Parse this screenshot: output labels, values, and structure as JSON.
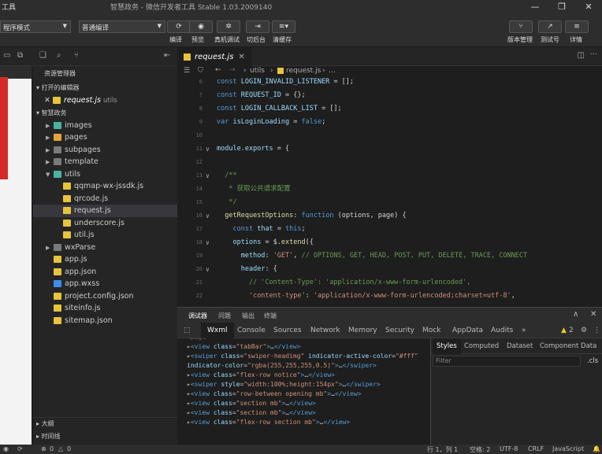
{
  "titlebar": {
    "app_name": "工具",
    "window_title": "智慧政务 - 微信开发者工具 Stable 1.03.2009140"
  },
  "toolbar": {
    "mode_select": "程序模式",
    "compile_select": "普通编译",
    "buttons": [
      "编译",
      "预览",
      "真机调试",
      "切后台",
      "清缓存"
    ],
    "right_buttons": [
      "版本管理",
      "测试号",
      "详情"
    ]
  },
  "explorer": {
    "header": "资源管理器",
    "open_editors": "打开的编辑器",
    "open_file": "request.js",
    "open_file_path": "utils",
    "project": "智慧政务",
    "items": [
      {
        "label": "images",
        "type": "folder",
        "indent": 1,
        "twisty": "▶",
        "color": "#4ab4a4"
      },
      {
        "label": "pages",
        "type": "folder",
        "indent": 1,
        "twisty": "▶",
        "color": "#e8a33c"
      },
      {
        "label": "subpages",
        "type": "folder",
        "indent": 1,
        "twisty": "▶",
        "color": "#7a7a7a"
      },
      {
        "label": "template",
        "type": "folder",
        "indent": 1,
        "twisty": "▶",
        "color": "#7a7a7a"
      },
      {
        "label": "utils",
        "type": "folder",
        "indent": 1,
        "twisty": "▼",
        "color": "#4ab4a4"
      },
      {
        "label": "qqmap-wx-jssdk.js",
        "type": "js",
        "indent": 2,
        "twisty": "",
        "color": "#e8c33c"
      },
      {
        "label": "qrcode.js",
        "type": "js",
        "indent": 2,
        "twisty": "",
        "color": "#e8c33c"
      },
      {
        "label": "request.js",
        "type": "js",
        "indent": 2,
        "twisty": "",
        "color": "#e8c33c",
        "selected": true
      },
      {
        "label": "underscore.js",
        "type": "js",
        "indent": 2,
        "twisty": "",
        "color": "#e8c33c"
      },
      {
        "label": "util.js",
        "type": "js",
        "indent": 2,
        "twisty": "",
        "color": "#e8c33c"
      },
      {
        "label": "wxParse",
        "type": "folder",
        "indent": 1,
        "twisty": "▶",
        "color": "#7a7a7a"
      },
      {
        "label": "app.js",
        "type": "js",
        "indent": 1,
        "twisty": "",
        "color": "#e8c33c"
      },
      {
        "label": "app.json",
        "type": "json",
        "indent": 1,
        "twisty": "",
        "color": "#e8c33c"
      },
      {
        "label": "app.wxss",
        "type": "wxss",
        "indent": 1,
        "twisty": "",
        "color": "#3c8ee8"
      },
      {
        "label": "project.config.json",
        "type": "json",
        "indent": 1,
        "twisty": "",
        "color": "#e8c33c"
      },
      {
        "label": "siteinfo.js",
        "type": "js",
        "indent": 1,
        "twisty": "",
        "color": "#e8c33c"
      },
      {
        "label": "sitemap.json",
        "type": "json",
        "indent": 1,
        "twisty": "",
        "color": "#e8c33c"
      }
    ],
    "outline": "大纲",
    "timeline": "时间线"
  },
  "editor": {
    "tab": "request.js",
    "breadcrumb_dir": "utils",
    "breadcrumb_file": "request.js"
  },
  "code": [
    {
      "ln": "6",
      "fold": "",
      "html": "<span class=\"bl\">const</span> <span class=\"nm\">LOGIN_INVALID_LISTENER</span> <span class=\"pl\">= [];</span>"
    },
    {
      "ln": "7",
      "fold": "",
      "html": "<span class=\"bl\">const</span> <span class=\"nm\">REQUEST_ID</span> <span class=\"pl\">= {};</span>"
    },
    {
      "ln": "8",
      "fold": "",
      "html": "<span class=\"bl\">const</span> <span class=\"nm\">LOGIN_CALLBACK_LIST</span> <span class=\"pl\">= [];</span>"
    },
    {
      "ln": "9",
      "fold": "",
      "html": "<span class=\"bl\">var</span> <span class=\"nm\">isLoginLoading</span> <span class=\"pl\">= </span><span class=\"bl\">false</span><span class=\"pl\">;</span>"
    },
    {
      "ln": "10",
      "fold": "",
      "html": ""
    },
    {
      "ln": "11",
      "fold": "∨",
      "html": "<span class=\"nm\">module</span><span class=\"pl\">.</span><span class=\"nm\">exports</span> <span class=\"pl\">= {</span>"
    },
    {
      "ln": "12",
      "fold": "",
      "html": ""
    },
    {
      "ln": "13",
      "fold": "∨",
      "html": "  <span class=\"cm\">/**</span>"
    },
    {
      "ln": "14",
      "fold": "",
      "html": "   <span class=\"cm\">* 获取公共请求配置</span>"
    },
    {
      "ln": "15",
      "fold": "",
      "html": "   <span class=\"cm\">*/</span>"
    },
    {
      "ln": "16",
      "fold": "∨",
      "html": "  <span class=\"fn\">getRequestOptions</span><span class=\"pl\">: </span><span class=\"bl\">function</span> <span class=\"pl\">(options, page) {</span>"
    },
    {
      "ln": "17",
      "fold": "",
      "html": "    <span class=\"bl\">const</span> <span class=\"nm\">that</span> <span class=\"pl\">= </span><span class=\"bl\">this</span><span class=\"pl\">;</span>"
    },
    {
      "ln": "18",
      "fold": "∨",
      "html": "    <span class=\"nm\">options</span> <span class=\"pl\">= $.</span><span class=\"fn\">extend</span><span class=\"pl\">({</span>"
    },
    {
      "ln": "19",
      "fold": "",
      "html": "      <span class=\"nm\">method</span><span class=\"pl\">: </span><span class=\"st\">'GET'</span><span class=\"pl\">, </span><span class=\"cm\">// OPTIONS, GET, HEAD, POST, PUT, DELETE, TRACE, CONNECT</span>"
    },
    {
      "ln": "20",
      "fold": "∨",
      "html": "      <span class=\"nm\">header</span><span class=\"pl\">: {</span>"
    },
    {
      "ln": "21",
      "fold": "",
      "html": "        <span class=\"cm\">// 'Content-Type': 'application/x-www-form-urlencoded',</span>"
    },
    {
      "ln": "22",
      "fold": "",
      "html": "        <span class=\"st\">'content-type'</span><span class=\"pl\">: </span><span class=\"st\">'application/x-www-form-urlencoded;charset=utf-8'</span><span class=\"pl\">,</span>"
    }
  ],
  "devtools": {
    "top_tabs": [
      "调试器",
      "问题",
      "输出",
      "终端"
    ],
    "tabs": [
      "Wxml",
      "Console",
      "Sources",
      "Network",
      "Memory",
      "Security",
      "Mock",
      "AppData",
      "Audits",
      "»"
    ],
    "warning_count": "2",
    "dom": [
      {
        "indent": 0,
        "html": "<span class=\"tg\">&lt;view </span><span class=\"at\">class</span>=<span class=\"av\">\"tabBar\"</span><span class=\"tg\">&gt;</span><span class=\"tx2\">…</span><span class=\"tg\">&lt;/view&gt;</span>"
      },
      {
        "indent": 0,
        "html": "<span class=\"tg\">&lt;swiper </span><span class=\"at\">class</span>=<span class=\"av\">\"swiper-headimg\"</span> <span class=\"at\">indicator-active-color</span>=<span class=\"av\">\"#fff\"</span>"
      },
      {
        "indent": -1,
        "html": "<span class=\"at\">indicator-color</span>=<span class=\"av\">\"rgba(255,255,255,0.5)\"</span><span class=\"tg\">&gt;</span><span class=\"tx2\">…</span><span class=\"tg\">&lt;/swiper&gt;</span>"
      },
      {
        "indent": 0,
        "html": "<span class=\"tg\">&lt;view </span><span class=\"at\">class</span>=<span class=\"av\">\"flex-row notice\"</span><span class=\"tg\">&gt;</span><span class=\"tx2\">…</span><span class=\"tg\">&lt;/view&gt;</span>"
      },
      {
        "indent": 0,
        "html": "<span class=\"tg\">&lt;swiper </span><span class=\"at\">style</span>=<span class=\"av\">\"width:100%;height:154px\"</span><span class=\"tg\">&gt;</span><span class=\"tx2\">…</span><span class=\"tg\">&lt;/swiper&gt;</span>"
      },
      {
        "indent": 0,
        "html": "<span class=\"tg\">&lt;view </span><span class=\"at\">class</span>=<span class=\"av\">\"row-between opening mb\"</span><span class=\"tg\">&gt;</span><span class=\"tx2\">…</span><span class=\"tg\">&lt;/view&gt;</span>"
      },
      {
        "indent": 0,
        "html": "<span class=\"tg\">&lt;view </span><span class=\"at\">class</span>=<span class=\"av\">\"section mb\"</span><span class=\"tg\">&gt;</span><span class=\"tx2\">…</span><span class=\"tg\">&lt;/view&gt;</span>"
      },
      {
        "indent": 0,
        "html": "<span class=\"tg\">&lt;view </span><span class=\"at\">class</span>=<span class=\"av\">\"section mb\"</span><span class=\"tg\">&gt;</span><span class=\"tx2\">…</span><span class=\"tg\">&lt;/view&gt;</span>"
      },
      {
        "indent": 0,
        "html": "<span class=\"tg\">&lt;view </span><span class=\"at\">class</span>=<span class=\"av\">\"flex-row section mb\"</span><span class=\"tg\">&gt;</span><span class=\"tx2\">…</span><span class=\"tg\">&lt;/view&gt;</span>"
      }
    ],
    "styles_tabs": [
      "Styles",
      "Computed",
      "Dataset",
      "Component Data"
    ],
    "filter_placeholder": "Filter",
    "cls_label": ".cls"
  },
  "statusbar": {
    "errors": "0",
    "warnings": "0",
    "position": "行 1，列 1",
    "spaces": "空格: 2",
    "encoding": "UTF-8",
    "eol": "CRLF",
    "language": "JavaScript"
  }
}
